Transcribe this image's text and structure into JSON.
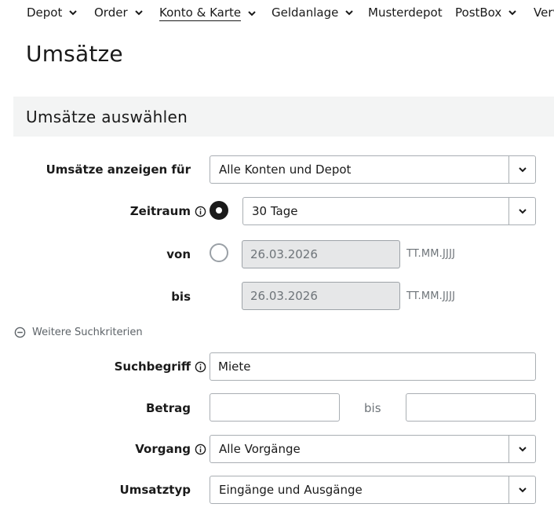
{
  "nav": {
    "items": [
      {
        "label": "Depot",
        "has_dropdown": true,
        "active": false
      },
      {
        "label": "Order",
        "has_dropdown": true,
        "active": false
      },
      {
        "label": "Konto & Karte",
        "has_dropdown": true,
        "active": true
      },
      {
        "label": "Geldanlage",
        "has_dropdown": true,
        "active": false
      },
      {
        "label": "Musterdepot",
        "has_dropdown": false,
        "active": false
      },
      {
        "label": "PostBox",
        "has_dropdown": true,
        "active": false
      },
      {
        "label": "Verv",
        "has_dropdown": false,
        "active": false
      }
    ]
  },
  "page": {
    "title": "Umsätze"
  },
  "section": {
    "title": "Umsätze auswählen"
  },
  "form": {
    "account": {
      "label": "Umsätze anzeigen für",
      "value": "Alle Konten und Depot"
    },
    "period": {
      "label": "Zeitraum",
      "value": "30 Tage",
      "selected": true
    },
    "from": {
      "label": "von",
      "value": "26.03.2026",
      "hint": "TT.MM.JJJJ",
      "selected": false
    },
    "to": {
      "label": "bis",
      "value": "26.03.2026",
      "hint": "TT.MM.JJJJ"
    },
    "more_criteria": {
      "label": "Weitere Suchkriterien",
      "expanded": true
    },
    "search": {
      "label": "Suchbegriff",
      "value": "Miete"
    },
    "amount": {
      "label": "Betrag",
      "from_value": "",
      "separator": "bis",
      "to_value": ""
    },
    "transaction": {
      "label": "Vorgang",
      "value": "Alle Vorgänge"
    },
    "type": {
      "label": "Umsatztyp",
      "value": "Eingänge und Ausgänge"
    }
  },
  "colors": {
    "text": "#1a1a1a",
    "section_bg": "#f3f4f4",
    "border": "#a9aeb3",
    "disabled_bg": "#e6e7e8"
  }
}
